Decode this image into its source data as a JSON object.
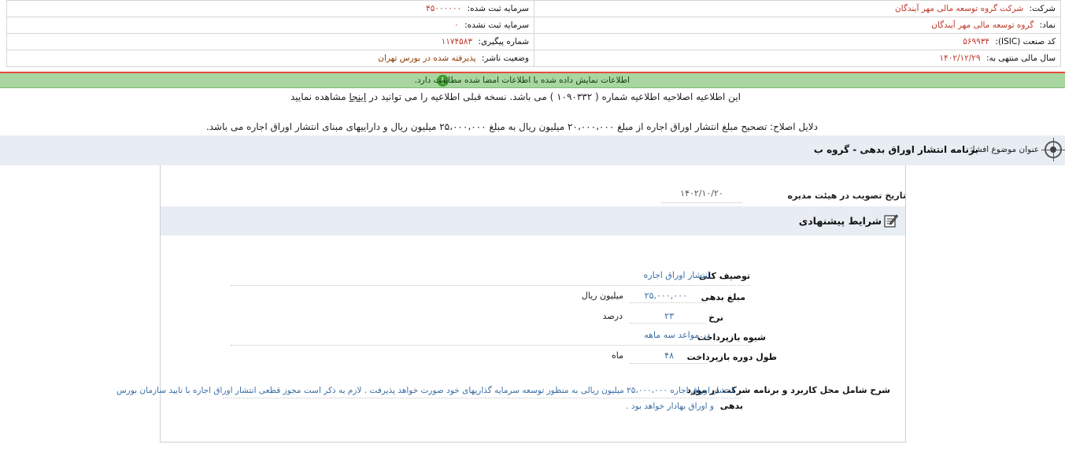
{
  "header": {
    "company_label": "شرکت:",
    "company_value": "شرکت گروه توسعه مالی مهر آیندگان",
    "registered_capital_label": "سرمایه ثبت شده:",
    "registered_capital_value": "۴۵۰۰۰۰۰۰",
    "symbol_label": "نماد:",
    "symbol_value": "گروه توسعه مالی مهر آیندگان",
    "unregistered_capital_label": "سرمایه ثبت نشده:",
    "unregistered_capital_value": "۰",
    "isic_label": "کد صنعت (ISIC):",
    "isic_value": "۵۶۹۹۳۴",
    "tracking_label": "شماره پیگیری:",
    "tracking_value": "۱۱۷۴۵۸۳",
    "fiscal_year_label": "سال مالی منتهی به:",
    "fiscal_year_value": "۱۴۰۲/۱۲/۲۹",
    "publisher_status_label": "وضعیت ناشر:",
    "publisher_status_value": "پذیرفته شده در بورس تهران"
  },
  "banner": {
    "text": "اطلاعات نمایش داده شده با اطلاعات امضا شده مطابقت دارد.",
    "icon": "info-icon",
    "color": "#a8d5a0"
  },
  "notice": {
    "prefix": "این اطلاعیه اصلاحیه اطلاعیه شماره ( ۱۰۹۰۳۳۲ ) می باشد. نسخه قبلی اطلاعیه را می توانید در ",
    "link": "اینجا",
    "suffix": " مشاهده نمایید"
  },
  "reason": {
    "text": "دلایل اصلاح: تصحیح مبلغ انتشار اوراق اجاره از مبلغ ۲۰،۰۰۰،۰۰۰ میلیون ریال به مبلغ ۲۵،۰۰۰،۰۰۰ میلیون ریال و داراییهای مبنای انتشار اوراق اجاره می باشد."
  },
  "subject": {
    "label": "عنوان موضوع افشا:",
    "value": "برنامه انتشار اوراق بدهی - گروه ب",
    "icon": "target-icon"
  },
  "approval": {
    "label": "تاریخ تصویب در هیئت مدیره",
    "value": "۱۴۰۲/۱۰/۲۰"
  },
  "conditions": {
    "title": "شرایط پیشنهادی",
    "icon": "edit-icon",
    "rows": [
      {
        "label": "توصیف کلی",
        "value": "انتشار اوراق اجاره",
        "unit": ""
      },
      {
        "label": "مبلغ بدهی",
        "value": "۲۵,۰۰۰,۰۰۰",
        "unit": "میلیون ریال"
      },
      {
        "label": "نرخ",
        "value": "۲۳",
        "unit": "درصد"
      },
      {
        "label": "شیوه بازپرداخت",
        "value": "در مواعد سه ماهه",
        "unit": ""
      },
      {
        "label": "طول دوره بازپرداخت",
        "value": "۴۸",
        "unit": "ماه"
      }
    ],
    "description_label_line1": "شرح شامل محل کاربرد و برنامه شرکت در مورد",
    "description_label_line2": "بدهی",
    "description_line1": "انتشار اوراق اجاره ۲۵،۰۰۰،۰۰۰ میلیون ریالی به منظور توسعه سرمایه گذاریهای خود صورت خواهد پذیرفت . لازم به ذکر است مجوز قطعی انتشار اوراق اجاره با تایید سازمان بورس",
    "description_line2": "و اوراق بهادار خواهد بود ."
  }
}
